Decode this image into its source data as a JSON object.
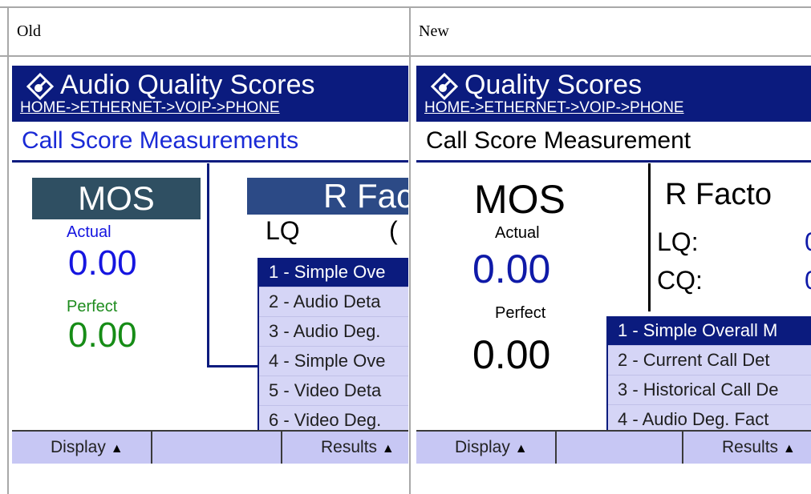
{
  "columns": {
    "old_label": "Old",
    "new_label": "New"
  },
  "old": {
    "title": "Audio Quality Scores",
    "breadcrumb": "HOME->ETHERNET->VOIP->PHONE",
    "section": "Call Score Measurements",
    "mos_label": "MOS",
    "actual_label": "Actual",
    "actual_value": "0.00",
    "perfect_label": "Perfect",
    "perfect_value": "0.00",
    "rfactor_label": "R Fac",
    "lq_label": "LQ",
    "lq_value_partial": "(",
    "menu": [
      "1 - Simple Ove",
      "2 - Audio Deta",
      "3 - Audio Deg.",
      "4 - Simple Ove",
      "5 - Video Deta",
      "6 - Video Deg."
    ],
    "display_button": "Display",
    "results_button": "Results",
    "colors": {
      "title_bg": "#0b1b7e",
      "section_text": "#1a2ad6",
      "actual_value": "#1515e0",
      "perfect_value": "#168c16",
      "perfect_label": "#1e8c1e",
      "mos_bg": "#2f4f62",
      "rfactor_bg": "#2c4a86"
    }
  },
  "new": {
    "title": "Quality Scores",
    "breadcrumb": "HOME->ETHERNET->VOIP->PHONE",
    "section": "Call Score Measurement",
    "mos_label": "MOS",
    "actual_label": "Actual",
    "actual_value": "0.00",
    "perfect_label": "Perfect",
    "perfect_value": "0.00",
    "rfactor_label": "R Facto",
    "lq_label": "LQ:",
    "lq_value_partial": "0",
    "cq_label": "CQ:",
    "cq_value_partial": "0",
    "menu": [
      "1 - Simple Overall M",
      "2 - Current Call Det",
      "3 - Historical Call De",
      "4 - Audio Deg. Fact"
    ],
    "display_button": "Display",
    "results_button": "Results",
    "colors": {
      "title_bg": "#0b1b7e",
      "actual_value": "#0f1aa8",
      "perfect_value": "#000000"
    }
  }
}
